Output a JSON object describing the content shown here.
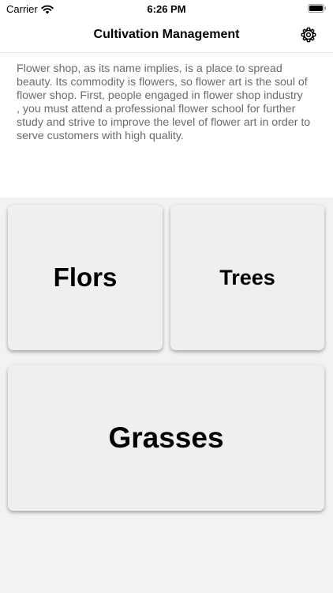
{
  "status_bar": {
    "carrier": "Carrier",
    "time": "6:26 PM",
    "wifi_icon": "wifi-icon",
    "battery_icon": "battery-icon"
  },
  "nav": {
    "title": "Cultivation Management",
    "settings_icon": "gear-icon"
  },
  "description": "Flower shop, as its name implies, is a place to spread beauty. Its commodity is flowers, so flower art is the soul of flower shop. First, people engaged in flower shop industry\n, you must attend a professional flower school for further study and strive to improve the level of flower art in order to serve customers with high quality.",
  "categories": [
    {
      "label": "Flors"
    },
    {
      "label": "Trees"
    },
    {
      "label": "Grasses"
    }
  ],
  "colors": {
    "background": "#ffffff",
    "category_area": "#f2f2f2",
    "card": "#efefef",
    "description_text": "#6b6b6b"
  }
}
